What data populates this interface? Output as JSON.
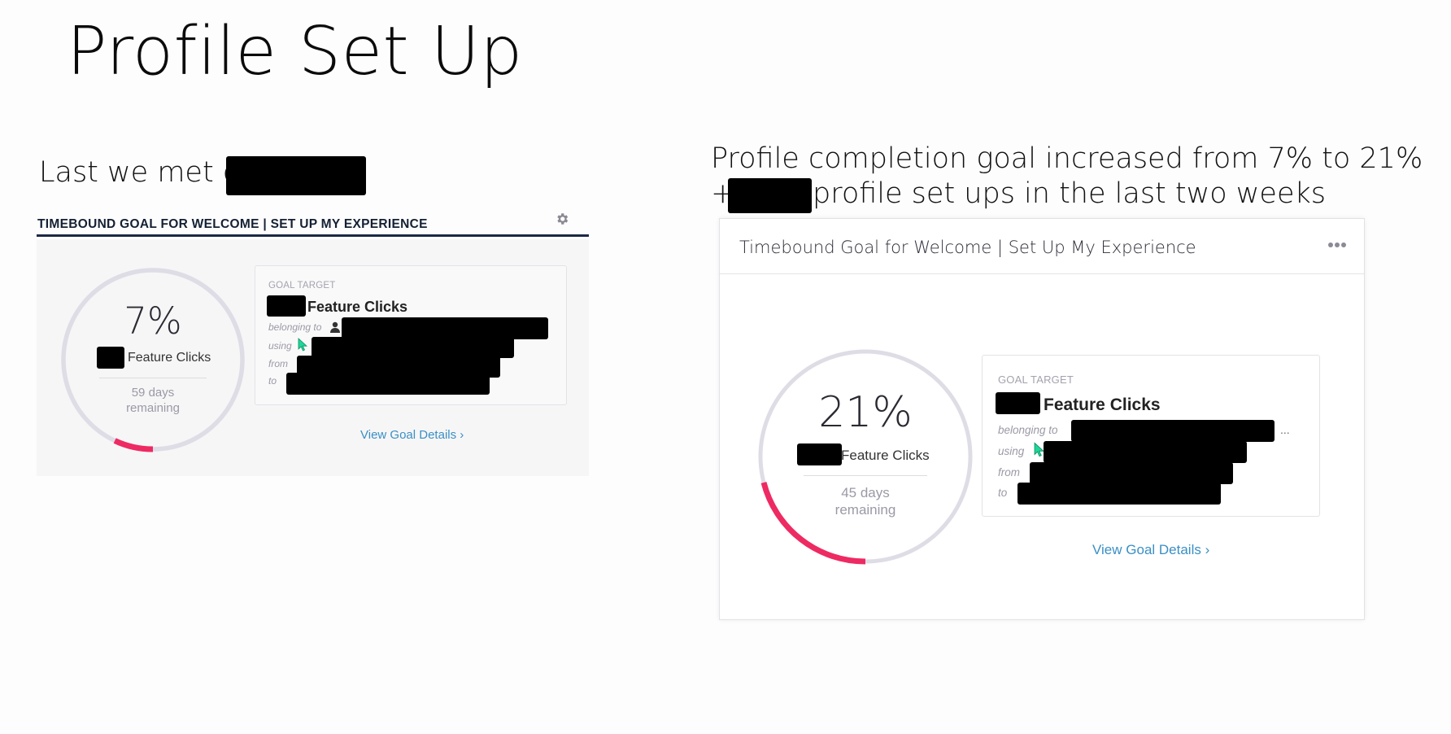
{
  "slide": {
    "title": "Profile Set Up",
    "left_caption": "Last we met on",
    "right_caption_line1": "Profile completion goal increased from 7% to 21%",
    "right_caption_plus": "+",
    "right_caption_line2": "profile set ups in the last two weeks"
  },
  "before_card": {
    "header": "TIMEBOUND GOAL FOR WELCOME | SET UP MY EXPERIENCE",
    "header_icon": "gear-icon",
    "progress": {
      "percent_text": "7%",
      "value": 0.07
    },
    "metric_label": "Feature Clicks",
    "days_line1": "59 days",
    "days_line2": "remaining",
    "goal_target_label": "GOAL TARGET",
    "goal_target_title": "Feature Clicks",
    "rows": {
      "belonging_to": "belonging to",
      "using": "using",
      "from": "from",
      "to": "to"
    },
    "link": "View Goal Details ›"
  },
  "after_card": {
    "header": "Timebound Goal for Welcome | Set Up My Experience",
    "menu_icon": "more-horizontal-icon",
    "progress": {
      "percent_text": "21%",
      "value": 0.21
    },
    "metric_label": "Feature Clicks",
    "days_line1": "45 days",
    "days_line2": "remaining",
    "goal_target_label": "GOAL TARGET",
    "goal_target_title": "Feature Clicks",
    "rows": {
      "belonging_to": "belonging to",
      "using": "using",
      "from": "from",
      "to": "to"
    },
    "truncation": "...",
    "link": "View Goal Details ›"
  },
  "colors": {
    "track": "#dedde6",
    "progress": "#ee2a62",
    "link": "#3a8fc4",
    "header_rule": "#1b2a44",
    "cursor": "#1fd69a"
  }
}
